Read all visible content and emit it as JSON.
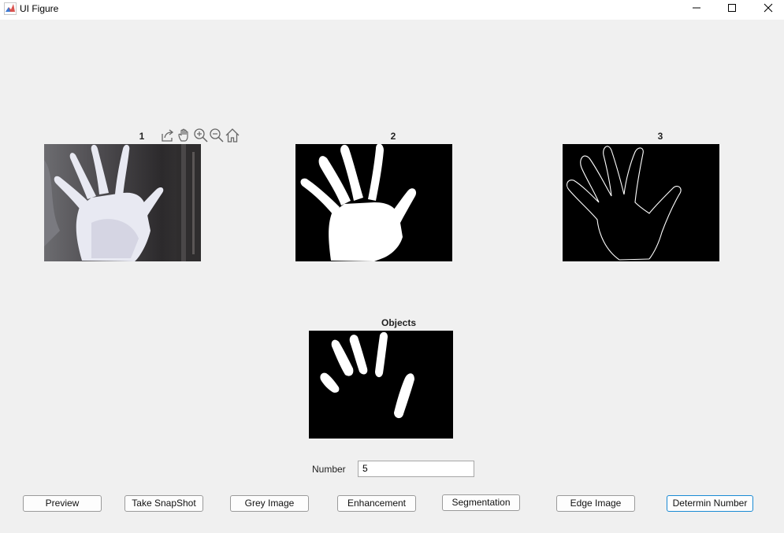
{
  "window": {
    "title": "UI Figure",
    "controls": [
      "minimize-icon",
      "maximize-icon",
      "close-icon"
    ]
  },
  "axes": [
    {
      "title": "1",
      "content": "webcam snapshot of an open hand"
    },
    {
      "title": "2",
      "content": "binary mask of the hand"
    },
    {
      "title": "3",
      "content": "edge image of the hand"
    },
    {
      "title": "Objects",
      "content": "segmented finger objects"
    }
  ],
  "axes_toolbar": [
    "export-icon",
    "pan-icon",
    "zoom-in-icon",
    "zoom-out-icon",
    "home-icon"
  ],
  "number": {
    "label": "Number",
    "value": "5"
  },
  "buttons": {
    "preview": "Preview",
    "snapshot": "Take SnapShot",
    "grey": "Grey Image",
    "enhancement": "Enhancement",
    "segmentation": "Segmentation",
    "edge": "Edge Image",
    "determine": "Determin Number"
  },
  "colors": {
    "focus_border": "#1a8ad4",
    "window_background": "#f0f0f0"
  }
}
